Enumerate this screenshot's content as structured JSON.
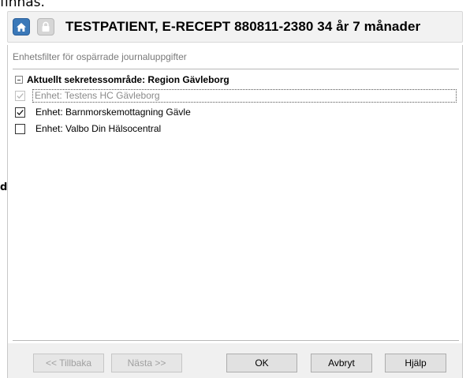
{
  "page": {
    "clipped_top_text": "finnas.",
    "clipped_left_text": "d"
  },
  "header": {
    "title": "TESTPATIENT, E-RECEPT  880811-2380  34 år 7 månader",
    "home_icon": "home-icon",
    "lock_icon": "lock-icon",
    "home_color": "#3a78b8"
  },
  "dialog": {
    "filter_label": "Enhetsfilter för ospärrade journaluppgifter",
    "group": {
      "label": "Aktuellt sekretessområde: Region Gävleborg"
    },
    "items": [
      {
        "label": "Enhet: Testens HC Gävleborg",
        "checked": true,
        "disabled": true
      },
      {
        "label": "Enhet: Barnmorskemottagning Gävle",
        "checked": true,
        "disabled": false
      },
      {
        "label": "Enhet: Valbo Din Hälsocentral",
        "checked": false,
        "disabled": false
      }
    ]
  },
  "buttons": {
    "back": "<< Tillbaka",
    "next": "Nästa >>",
    "ok": "OK",
    "cancel": "Avbryt",
    "help": "Hjälp"
  }
}
